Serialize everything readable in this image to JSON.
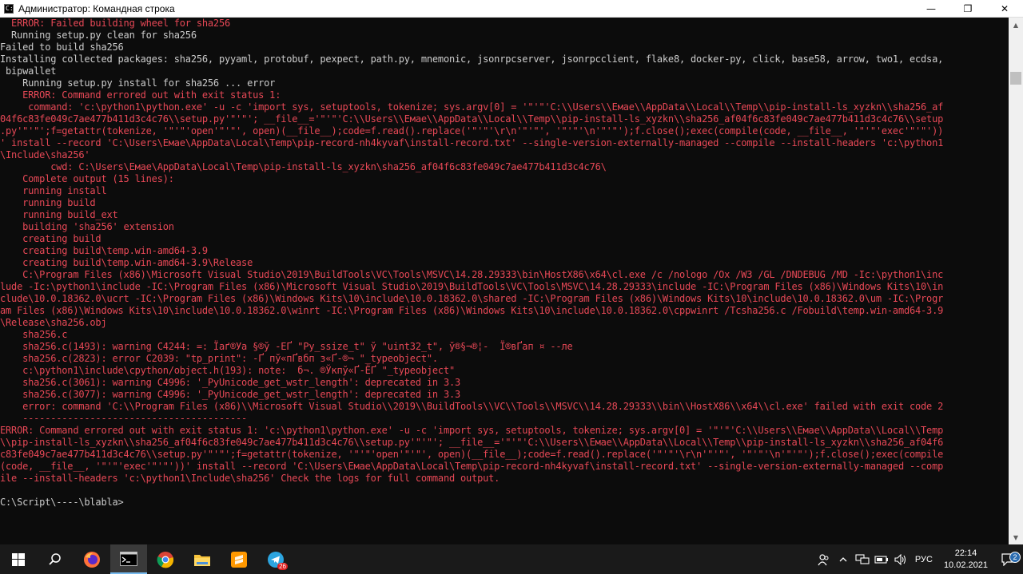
{
  "window": {
    "title": "Администратор: Командная строка",
    "app_icon_text": "C:\\",
    "minimize_glyph": "—",
    "maximize_glyph": "❐",
    "close_glyph": "✕"
  },
  "console": {
    "lines": [
      {
        "text": "  ERROR: Failed building wheel for sha256",
        "kind": "err"
      },
      {
        "text": "  Running setup.py clean for sha256",
        "kind": "norm"
      },
      {
        "text": "Failed to build sha256",
        "kind": "norm"
      },
      {
        "text": "Installing collected packages: sha256, pyyaml, protobuf, pexpect, path.py, mnemonic, jsonrpcserver, jsonrpcclient, flake8, docker-py, click, base58, arrow, two1, ecdsa,",
        "kind": "norm"
      },
      {
        "text": " bipwallet",
        "kind": "norm"
      },
      {
        "text": "    Running setup.py install for sha256 ... error",
        "kind": "norm"
      },
      {
        "text": "    ERROR: Command errored out with exit status 1:",
        "kind": "err"
      },
      {
        "text": "     command: 'c:\\python1\\python.exe' -u -c 'import sys, setuptools, tokenize; sys.argv[0] = '\"'\"'C:\\\\Users\\\\Емае\\\\AppData\\\\Local\\\\Temp\\\\pip-install-ls_xyzkn\\\\sha256_af",
        "kind": "err"
      },
      {
        "text": "04f6c83fe049c7ae477b411d3c4c76\\\\setup.py'\"'\"'; __file__='\"'\"'C:\\\\Users\\\\Емае\\\\AppData\\\\Local\\\\Temp\\\\pip-install-ls_xyzkn\\\\sha256_af04f6c83fe049c7ae477b411d3c4c76\\\\setup",
        "kind": "err"
      },
      {
        "text": ".py'\"'\"';f=getattr(tokenize, '\"'\"'open'\"'\"', open)(__file__);code=f.read().replace('\"'\"'\\r\\n'\"'\"', '\"'\"'\\n'\"'\"');f.close();exec(compile(code, __file__, '\"'\"'exec'\"'\"'))",
        "kind": "err"
      },
      {
        "text": "' install --record 'C:\\Users\\Емае\\AppData\\Local\\Temp\\pip-record-nh4kyvaf\\install-record.txt' --single-version-externally-managed --compile --install-headers 'c:\\python1",
        "kind": "err"
      },
      {
        "text": "\\Include\\sha256'",
        "kind": "err"
      },
      {
        "text": "         cwd: C:\\Users\\Емае\\AppData\\Local\\Temp\\pip-install-ls_xyzkn\\sha256_af04f6c83fe049c7ae477b411d3c4c76\\",
        "kind": "err"
      },
      {
        "text": "    Complete output (15 lines):",
        "kind": "err"
      },
      {
        "text": "    running install",
        "kind": "err"
      },
      {
        "text": "    running build",
        "kind": "err"
      },
      {
        "text": "    running build_ext",
        "kind": "err"
      },
      {
        "text": "    building 'sha256' extension",
        "kind": "err"
      },
      {
        "text": "    creating build",
        "kind": "err"
      },
      {
        "text": "    creating build\\temp.win-amd64-3.9",
        "kind": "err"
      },
      {
        "text": "    creating build\\temp.win-amd64-3.9\\Release",
        "kind": "err"
      },
      {
        "text": "    C:\\Program Files (x86)\\Microsoft Visual Studio\\2019\\BuildTools\\VC\\Tools\\MSVC\\14.28.29333\\bin\\HostX86\\x64\\cl.exe /c /nologo /Ox /W3 /GL /DNDEBUG /MD -Ic:\\python1\\inc",
        "kind": "err"
      },
      {
        "text": "lude -Ic:\\python1\\include -IC:\\Program Files (x86)\\Microsoft Visual Studio\\2019\\BuildTools\\VC\\Tools\\MSVC\\14.28.29333\\include -IC:\\Program Files (x86)\\Windows Kits\\10\\in",
        "kind": "err"
      },
      {
        "text": "clude\\10.0.18362.0\\ucrt -IC:\\Program Files (x86)\\Windows Kits\\10\\include\\10.0.18362.0\\shared -IC:\\Program Files (x86)\\Windows Kits\\10\\include\\10.0.18362.0\\um -IC:\\Progr",
        "kind": "err"
      },
      {
        "text": "am Files (x86)\\Windows Kits\\10\\include\\10.0.18362.0\\winrt -IC:\\Program Files (x86)\\Windows Kits\\10\\include\\10.0.18362.0\\cppwinrt /Tcsha256.c /Fobuild\\temp.win-amd64-3.9",
        "kind": "err"
      },
      {
        "text": "\\Release\\sha256.obj",
        "kind": "err"
      },
      {
        "text": "    sha256.c",
        "kind": "err"
      },
      {
        "text": "    sha256.c(1493): warning C4244: =: Їаґ®Уа §®ў -ЕҐ \"Py_ssize_t\" ў \"uint32_t\", ў®§¬®¦-  Ї®вҐап ¤ --ле",
        "kind": "err"
      },
      {
        "text": "    sha256.c(2823): error C2039: \"tp_print\": -Ґ пў«пҐвбп з«Ґ-®¬ \"_typeobject\".",
        "kind": "err"
      },
      {
        "text": "    c:\\python1\\include\\cpython/object.h(193): note:  б¬. ®Ўкпў«Ґ-ЁҐ \"_typeobject\"",
        "kind": "err"
      },
      {
        "text": "    sha256.c(3061): warning C4996: '_PyUnicode_get_wstr_length': deprecated in 3.3",
        "kind": "err"
      },
      {
        "text": "    sha256.c(3077): warning C4996: '_PyUnicode_get_wstr_length': deprecated in 3.3",
        "kind": "err"
      },
      {
        "text": "    error: command 'C:\\\\Program Files (x86)\\\\Microsoft Visual Studio\\\\2019\\\\BuildTools\\\\VC\\\\Tools\\\\MSVC\\\\14.28.29333\\\\bin\\\\HostX86\\\\x64\\\\cl.exe' failed with exit code 2",
        "kind": "err"
      },
      {
        "text": "    ----------------------------------------",
        "kind": "err"
      },
      {
        "text": "ERROR: Command errored out with exit status 1: 'c:\\python1\\python.exe' -u -c 'import sys, setuptools, tokenize; sys.argv[0] = '\"'\"'C:\\\\Users\\\\Емае\\\\AppData\\\\Local\\\\Temp",
        "kind": "err"
      },
      {
        "text": "\\\\pip-install-ls_xyzkn\\\\sha256_af04f6c83fe049c7ae477b411d3c4c76\\\\setup.py'\"'\"'; __file__='\"'\"'C:\\\\Users\\\\Емае\\\\AppData\\\\Local\\\\Temp\\\\pip-install-ls_xyzkn\\\\sha256_af04f6",
        "kind": "err"
      },
      {
        "text": "c83fe049c7ae477b411d3c4c76\\\\setup.py'\"'\"';f=getattr(tokenize, '\"'\"'open'\"'\"', open)(__file__);code=f.read().replace('\"'\"'\\r\\n'\"'\"', '\"'\"'\\n'\"'\"');f.close();exec(compile",
        "kind": "err"
      },
      {
        "text": "(code, __file__, '\"'\"'exec'\"'\"'))' install --record 'C:\\Users\\Емае\\AppData\\Local\\Temp\\pip-record-nh4kyvaf\\install-record.txt' --single-version-externally-managed --comp",
        "kind": "err"
      },
      {
        "text": "ile --install-headers 'c:\\python1\\Include\\sha256' Check the logs for full command output.",
        "kind": "err"
      },
      {
        "text": "",
        "kind": "norm"
      },
      {
        "text": "C:\\Script\\----\\blabla>",
        "kind": "norm"
      }
    ]
  },
  "scrollbar": {
    "up_glyph": "▲",
    "down_glyph": "▼"
  },
  "taskbar": {
    "apps": [
      {
        "name": "start-button",
        "icon": "windows-icon"
      },
      {
        "name": "search-button",
        "icon": "search-icon"
      },
      {
        "name": "taskbar-firefox",
        "icon": "firefox-icon"
      },
      {
        "name": "taskbar-cmd",
        "icon": "cmd-icon",
        "active": true
      },
      {
        "name": "taskbar-chrome",
        "icon": "chrome-icon"
      },
      {
        "name": "taskbar-explorer",
        "icon": "folder-icon"
      },
      {
        "name": "taskbar-sublime",
        "icon": "sublime-icon"
      },
      {
        "name": "taskbar-telegram",
        "icon": "telegram-icon"
      }
    ],
    "telegram_badge": "26",
    "tray": {
      "language": "РУС",
      "time": "22:14",
      "date": "10.02.2021",
      "notification_count": "2"
    }
  }
}
